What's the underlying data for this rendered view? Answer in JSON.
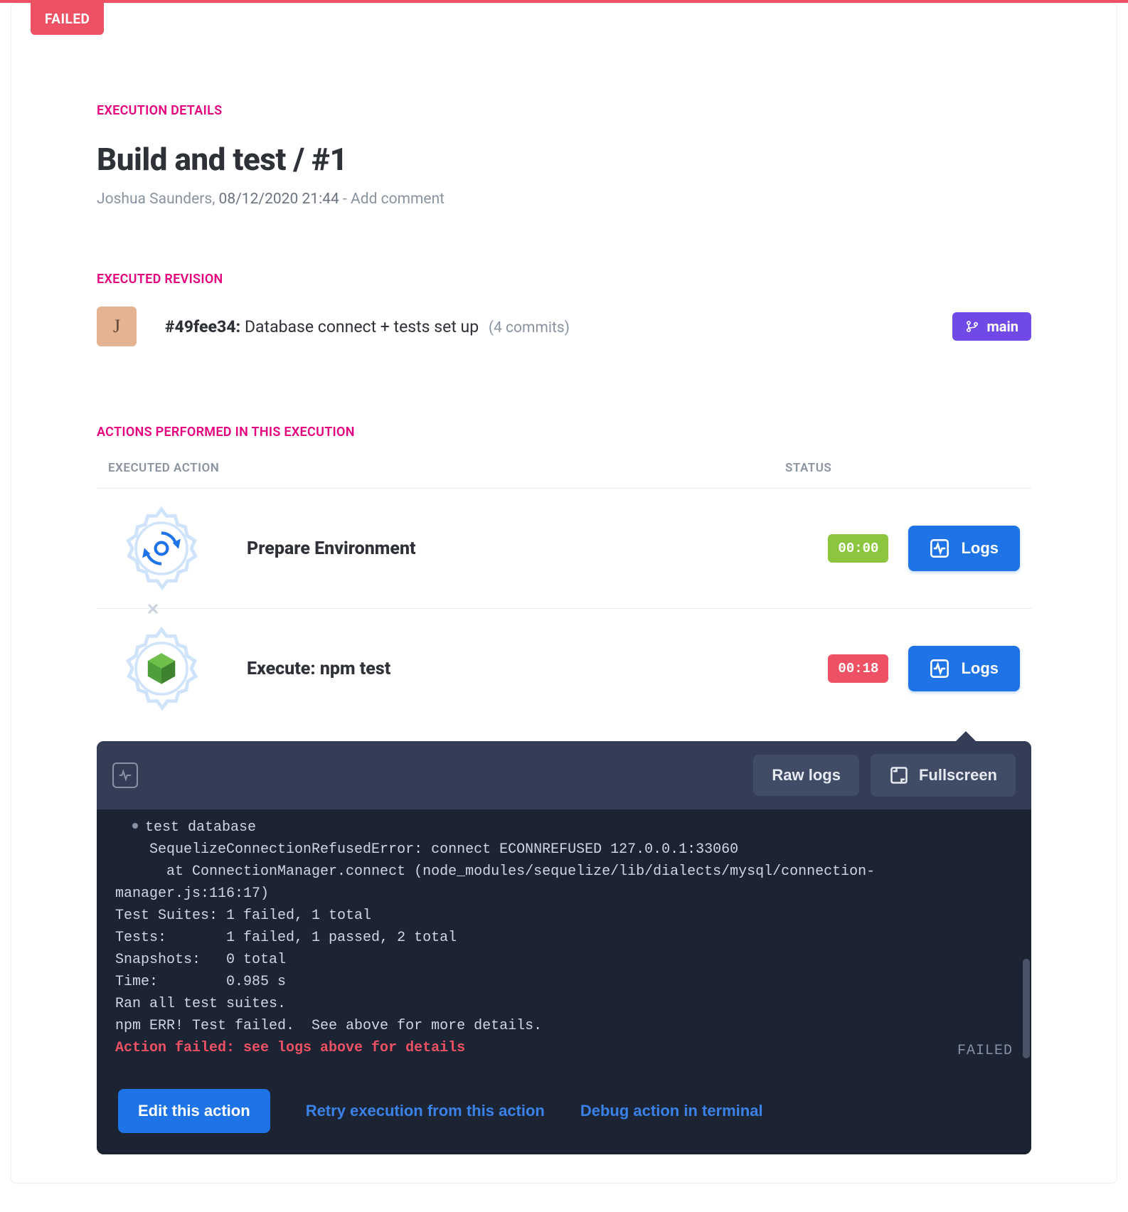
{
  "statusBadge": "FAILED",
  "details": {
    "label": "EXECUTION DETAILS",
    "title": "Build and test / #1",
    "author": "Joshua Saunders",
    "datetime": "08/12/2020 21:44",
    "addComment": "Add comment"
  },
  "revision": {
    "label": "EXECUTED REVISION",
    "avatarInitial": "J",
    "hash": "#49fee34:",
    "message": "Database connect + tests set up",
    "commits": "(4 commits)",
    "branch": "main"
  },
  "actions": {
    "label": "ACTIONS PERFORMED IN THIS EXECUTION",
    "colAction": "EXECUTED ACTION",
    "colStatus": "STATUS",
    "items": [
      {
        "name": "Prepare Environment",
        "time": "00:00",
        "timeClass": "green"
      },
      {
        "name": "Execute: npm test",
        "time": "00:18",
        "timeClass": "red"
      }
    ],
    "logsLabel": "Logs"
  },
  "logPanel": {
    "rawLogs": "Raw logs",
    "fullscreen": "Fullscreen",
    "lines": {
      "l0": "test database",
      "l1": "    SequelizeConnectionRefusedError: connect ECONNREFUSED 127.0.0.1:33060",
      "l2": "      at ConnectionManager.connect (node_modules/sequelize/lib/dialects/mysql/connection-",
      "l3": "manager.js:116:17)",
      "l4": "Test Suites: 1 failed, 1 total",
      "l5": "Tests:       1 failed, 1 passed, 2 total",
      "l6": "Snapshots:   0 total",
      "l7": "Time:        0.985 s",
      "l8": "Ran all test suites.",
      "l9": "npm ERR! Test failed.  See above for more details.",
      "err": "Action failed: see logs above for details"
    },
    "failedTag": "FAILED",
    "editAction": "Edit this action",
    "retry": "Retry execution from this action",
    "debug": "Debug action in terminal"
  }
}
